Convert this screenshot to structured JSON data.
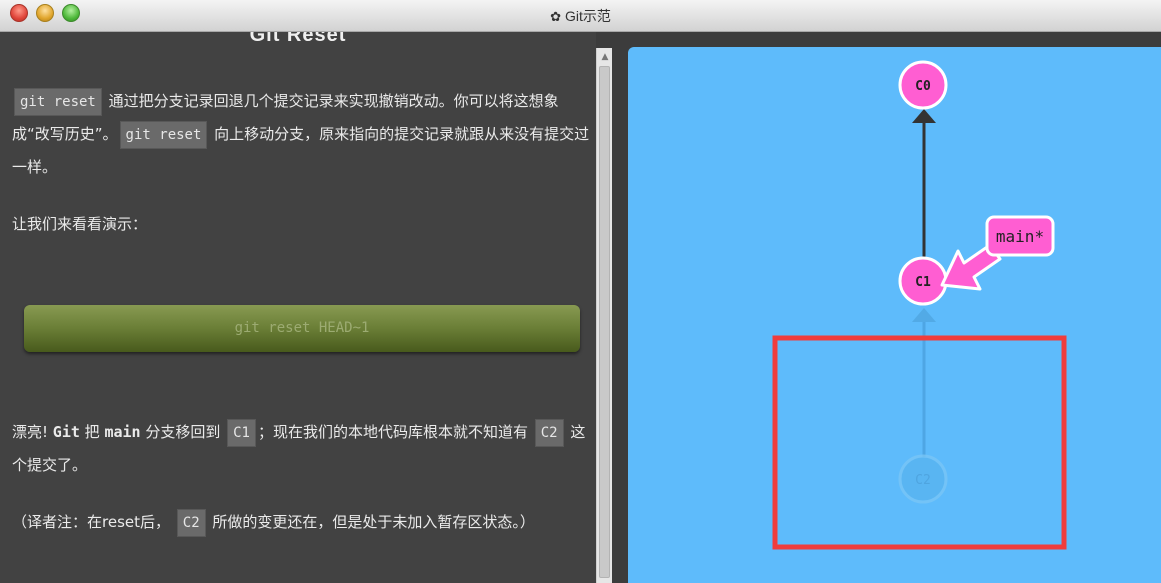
{
  "window": {
    "title": "Git示范",
    "title_icon": "gear-icon"
  },
  "lesson": {
    "heading": "Git Reset",
    "p1": {
      "code1": "git reset",
      "text1": " 通过把分支记录回退几个提交记录来实现撤销改动。你可以将这想象成“改写历史”。",
      "code2": "git reset",
      "text2": " 向上移动分支，原来指向的提交记录就跟从来没有提交过一样。"
    },
    "p2": "让我们来看看演示：",
    "demo_button": "git reset HEAD~1",
    "p3": {
      "text1": "漂亮! ",
      "git": "Git",
      "text2": " 把 ",
      "main": "main",
      "text3": " 分支移回到 ",
      "code1": "C1",
      "text4": "；现在我们的本地代码库根本就不知道有 ",
      "code2": "C2",
      "text5": " 这个提交了。"
    },
    "p4": {
      "text1": "（译者注：在reset后， ",
      "code1": "C2",
      "text2": " 所做的变更还在，但是处于未加入暂存区状态。）"
    }
  },
  "graph": {
    "commits": [
      {
        "id": "C0",
        "state": "active"
      },
      {
        "id": "C1",
        "state": "active"
      },
      {
        "id": "C2",
        "state": "faded"
      }
    ],
    "branch": {
      "label": "main*",
      "target": "C1"
    },
    "colors": {
      "background": "#5ebbfb",
      "commit": "#ff5ed2",
      "branch": "#ff5ed2",
      "highlight": "#f03c3c",
      "edge": "#333333"
    }
  }
}
